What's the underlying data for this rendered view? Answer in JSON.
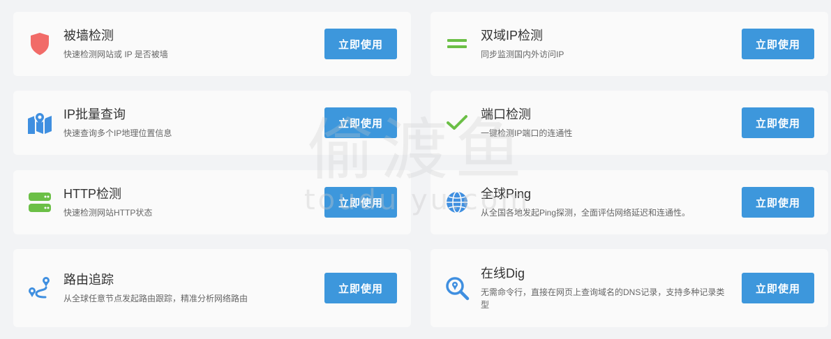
{
  "colors": {
    "accent_button": "#3d97dc",
    "shield_red": "#f16b68",
    "green": "#6bbf46",
    "blue_icon": "#3f8fe0"
  },
  "tools": [
    {
      "title": "被墙检测",
      "desc": "快速检测网站或 IP 是否被墙",
      "button": "立即使用",
      "icon": "shield-icon"
    },
    {
      "title": "双域IP检测",
      "desc": "同步监测国内外访问IP",
      "button": "立即使用",
      "icon": "equals-icon"
    },
    {
      "title": "IP批量查询",
      "desc": "快速查询多个IP地理位置信息",
      "button": "立即使用",
      "icon": "map-icon"
    },
    {
      "title": "端口检测",
      "desc": "一键检测IP端口的连通性",
      "button": "立即使用",
      "icon": "check-icon"
    },
    {
      "title": "HTTP检测",
      "desc": "快速检测网站HTTP状态",
      "button": "立即使用",
      "icon": "server-icon"
    },
    {
      "title": "全球Ping",
      "desc": "从全国各地发起Ping探测，全面评估网络延迟和连通性。",
      "button": "立即使用",
      "icon": "globe-icon"
    },
    {
      "title": "路由追踪",
      "desc": "从全球任意节点发起路由跟踪，精准分析网络路由",
      "button": "立即使用",
      "icon": "route-icon"
    },
    {
      "title": "在线Dig",
      "desc": "无需命令行，直接在网页上查询域名的DNS记录，支持多种记录类型",
      "button": "立即使用",
      "icon": "search-location-icon"
    }
  ],
  "watermark": {
    "cn": "偷渡鱼",
    "en": "toudu yu.com"
  }
}
